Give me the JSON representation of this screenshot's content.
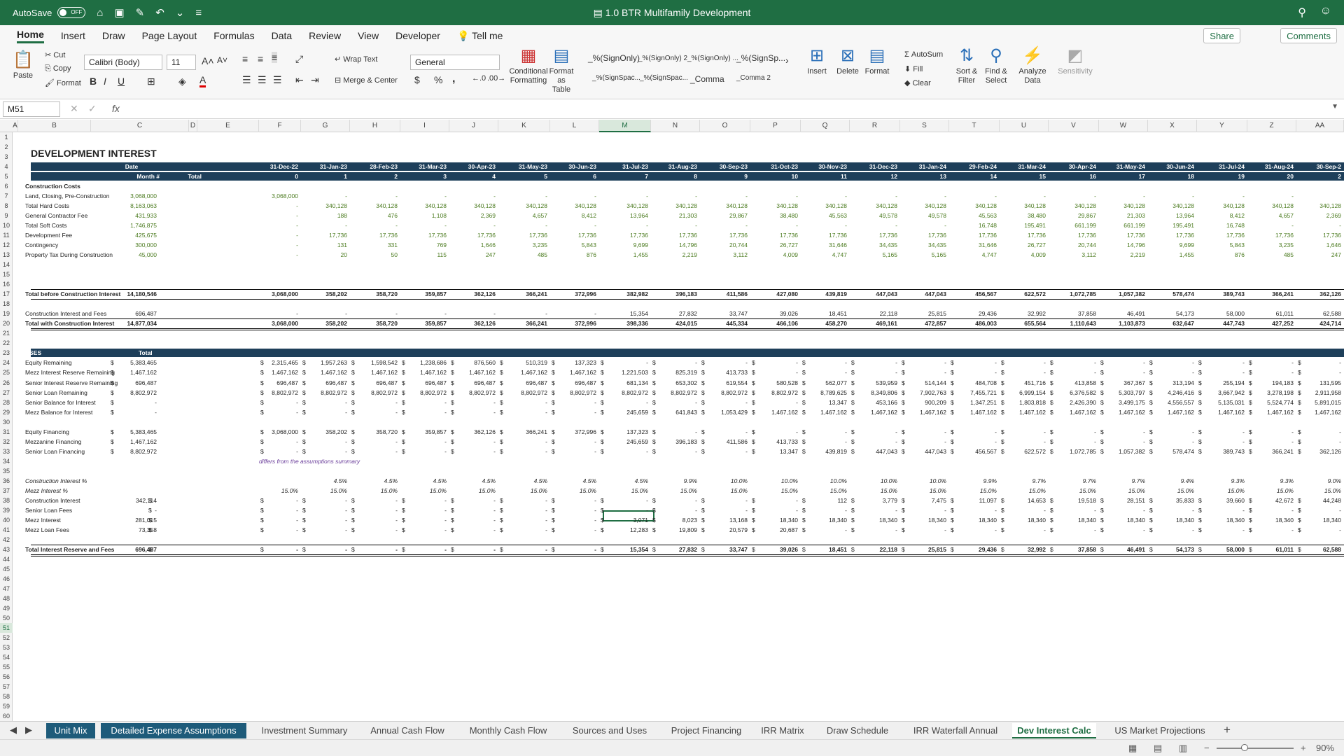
{
  "app": {
    "autosave_label": "AutoSave",
    "autosave_state": "OFF",
    "title": "1.0 BTR Multifamily Development"
  },
  "menu": [
    "Home",
    "Insert",
    "Draw",
    "Page Layout",
    "Formulas",
    "Data",
    "Review",
    "View",
    "Developer",
    "Tell me"
  ],
  "share": "Share",
  "comments": "Comments",
  "ribbon": {
    "paste": "Paste",
    "cut": "Cut",
    "copy": "Copy",
    "format_painter": "Format",
    "font_name": "Calibri (Body)",
    "font_size": "11",
    "bold": "B",
    "italic": "I",
    "underline": "U",
    "wrap_text": "Wrap Text",
    "merge_center": "Merge & Center",
    "number_format": "General",
    "currency": "$",
    "percent": "%",
    "comma": ",",
    "conditional_formatting": "Conditional Formatting",
    "format_as_table": "Format as Table",
    "styles": [
      "_%(SignOnly)",
      "_%(SignOnly) 2",
      "_%(SignOnly) ...",
      "_%(SignSp...",
      "_%(SignSpac...",
      "_%(SignSpac...",
      "_Comma",
      "_Comma 2"
    ],
    "insert": "Insert",
    "delete": "Delete",
    "format": "Format",
    "autosum": "AutoSum",
    "fill": "Fill",
    "clear": "Clear",
    "sort_filter": "Sort & Filter",
    "find_select": "Find & Select",
    "analyze_data": "Analyze Data",
    "sensitivity": "Sensitivity"
  },
  "formula_bar": {
    "name_box": "M51",
    "fx": "fx",
    "formula": ""
  },
  "columns": [
    "A",
    "B",
    "C",
    "D",
    "E",
    "F",
    "G",
    "H",
    "I",
    "J",
    "K",
    "L",
    "M",
    "N",
    "O",
    "P",
    "Q",
    "R",
    "S",
    "T",
    "U",
    "V",
    "W",
    "X",
    "Y",
    "Z",
    "AA"
  ],
  "selected_column": "M",
  "selected_row": "51",
  "rows": [
    "1",
    "2",
    "3",
    "4",
    "5",
    "6",
    "7",
    "8",
    "9",
    "10",
    "11",
    "12",
    "13",
    "14",
    "15",
    "16",
    "17",
    "18",
    "19",
    "20",
    "21",
    "22",
    "23",
    "24",
    "25",
    "26",
    "27",
    "28",
    "29",
    "30",
    "31",
    "32",
    "33",
    "34",
    "35",
    "36",
    "37",
    "38",
    "39",
    "40",
    "41",
    "42",
    "43",
    "44",
    "45",
    "46",
    "47",
    "48",
    "49",
    "50",
    "51",
    "52",
    "53",
    "54",
    "55",
    "56",
    "57",
    "58",
    "59",
    "60"
  ],
  "sheet": {
    "title": "DEVELOPMENT INTEREST",
    "date_label": "Date",
    "month_label": "Month #",
    "total_label": "Total",
    "dates": [
      "31-Dec-22",
      "31-Jan-23",
      "28-Feb-23",
      "31-Mar-23",
      "30-Apr-23",
      "31-May-23",
      "30-Jun-23",
      "31-Jul-23",
      "31-Aug-23",
      "30-Sep-23",
      "31-Oct-23",
      "30-Nov-23",
      "31-Dec-23",
      "31-Jan-24",
      "29-Feb-24",
      "31-Mar-24",
      "30-Apr-24",
      "31-May-24",
      "30-Jun-24",
      "31-Jul-24",
      "31-Aug-24",
      "30-Sep-2"
    ],
    "months": [
      "0",
      "1",
      "2",
      "3",
      "4",
      "5",
      "6",
      "7",
      "8",
      "9",
      "10",
      "11",
      "12",
      "13",
      "14",
      "15",
      "16",
      "17",
      "18",
      "19",
      "20",
      "2"
    ],
    "construction_costs_label": "Construction Costs",
    "cost_rows": [
      {
        "label": "Land, Closing, Pre-Construction",
        "total": "3,068,000",
        "vals": [
          "3,068,000",
          "-",
          "-",
          "-",
          "-",
          "-",
          "-",
          "-",
          "-",
          "-",
          "-",
          "-",
          "-",
          "-",
          "-",
          "-",
          "-",
          "-",
          "-",
          "-",
          "-",
          ""
        ]
      },
      {
        "label": "Total Hard Costs",
        "total": "8,163,063",
        "vals": [
          "-",
          "340,128",
          "340,128",
          "340,128",
          "340,128",
          "340,128",
          "340,128",
          "340,128",
          "340,128",
          "340,128",
          "340,128",
          "340,128",
          "340,128",
          "340,128",
          "340,128",
          "340,128",
          "340,128",
          "340,128",
          "340,128",
          "340,128",
          "340,128",
          "340,128"
        ]
      },
      {
        "label": "General Contractor Fee",
        "total": "431,933",
        "vals": [
          "-",
          "188",
          "476",
          "1,108",
          "2,369",
          "4,657",
          "8,412",
          "13,964",
          "21,303",
          "29,867",
          "38,480",
          "45,563",
          "49,578",
          "49,578",
          "45,563",
          "38,480",
          "29,867",
          "21,303",
          "13,964",
          "8,412",
          "4,657",
          "2,369"
        ]
      },
      {
        "label": "Total Soft Costs",
        "total": "1,746,875",
        "vals": [
          "-",
          "-",
          "-",
          "-",
          "-",
          "-",
          "-",
          "-",
          "-",
          "-",
          "-",
          "-",
          "-",
          "-",
          "16,748",
          "195,491",
          "661,199",
          "661,199",
          "195,491",
          "16,748",
          "-",
          "-"
        ]
      },
      {
        "label": "Development Fee",
        "total": "425,675",
        "vals": [
          "-",
          "17,736",
          "17,736",
          "17,736",
          "17,736",
          "17,736",
          "17,736",
          "17,736",
          "17,736",
          "17,736",
          "17,736",
          "17,736",
          "17,736",
          "17,736",
          "17,736",
          "17,736",
          "17,736",
          "17,736",
          "17,736",
          "17,736",
          "17,736",
          "17,736"
        ]
      },
      {
        "label": "Contingency",
        "total": "300,000",
        "vals": [
          "-",
          "131",
          "331",
          "769",
          "1,646",
          "3,235",
          "5,843",
          "9,699",
          "14,796",
          "20,744",
          "26,727",
          "31,646",
          "34,435",
          "34,435",
          "31,646",
          "26,727",
          "20,744",
          "14,796",
          "9,699",
          "5,843",
          "3,235",
          "1,646"
        ]
      },
      {
        "label": "Property Tax During Construction",
        "total": "45,000",
        "vals": [
          "-",
          "20",
          "50",
          "115",
          "247",
          "485",
          "876",
          "1,455",
          "2,219",
          "3,112",
          "4,009",
          "4,747",
          "5,165",
          "5,165",
          "4,747",
          "4,009",
          "3,112",
          "2,219",
          "1,455",
          "876",
          "485",
          "247"
        ]
      }
    ],
    "total_before": {
      "label": "Total before Construction Interest",
      "total": "14,180,546",
      "vals": [
        "3,068,000",
        "358,202",
        "358,720",
        "359,857",
        "362,126",
        "366,241",
        "372,996",
        "382,982",
        "396,183",
        "411,586",
        "427,080",
        "439,819",
        "447,043",
        "447,043",
        "456,567",
        "622,572",
        "1,072,785",
        "1,057,382",
        "578,474",
        "389,743",
        "366,241",
        "362,126"
      ]
    },
    "construction_interest": {
      "label": "Construction Interest and Fees",
      "total": "696,487",
      "vals": [
        "-",
        "-",
        "-",
        "-",
        "-",
        "-",
        "-",
        "15,354",
        "27,832",
        "33,747",
        "39,026",
        "18,451",
        "22,118",
        "25,815",
        "29,436",
        "32,992",
        "37,858",
        "46,491",
        "54,173",
        "58,000",
        "61,011",
        "62,588"
      ]
    },
    "total_with": {
      "label": "Total with Construction Interest",
      "total": "14,877,034",
      "vals": [
        "3,068,000",
        "358,202",
        "358,720",
        "359,857",
        "362,126",
        "366,241",
        "372,996",
        "398,336",
        "424,015",
        "445,334",
        "466,106",
        "458,270",
        "469,161",
        "472,857",
        "486,003",
        "655,564",
        "1,110,643",
        "1,103,873",
        "632,647",
        "447,743",
        "427,252",
        "424,714"
      ]
    },
    "uses_label": "USES",
    "uses_total_label": "Total",
    "uses_rows": [
      {
        "label": "Equity Remaining",
        "total": "5,383,465",
        "vals": [
          "2,315,465",
          "1,957,263",
          "1,598,542",
          "1,238,686",
          "876,560",
          "510,319",
          "137,323",
          "-",
          "-",
          "-",
          "-",
          "-",
          "-",
          "-",
          "-",
          "-",
          "-",
          "-",
          "-",
          "-",
          "-",
          "-"
        ]
      },
      {
        "label": "Mezz Interest Reserve  Remaining",
        "total": "1,467,162",
        "vals": [
          "1,467,162",
          "1,467,162",
          "1,467,162",
          "1,467,162",
          "1,467,162",
          "1,467,162",
          "1,467,162",
          "1,221,503",
          "825,319",
          "413,733",
          "-",
          "-",
          "-",
          "-",
          "-",
          "-",
          "-",
          "-",
          "-",
          "-",
          "-",
          "-"
        ]
      },
      {
        "label": "Senior Interest Reserve Remaining",
        "total": "696,487",
        "vals": [
          "696,487",
          "696,487",
          "696,487",
          "696,487",
          "696,487",
          "696,487",
          "696,487",
          "681,134",
          "653,302",
          "619,554",
          "580,528",
          "562,077",
          "539,959",
          "514,144",
          "484,708",
          "451,716",
          "413,858",
          "367,367",
          "313,194",
          "255,194",
          "194,183",
          "131,595"
        ]
      },
      {
        "label": "Senior Loan Remaining",
        "total": "8,802,972",
        "vals": [
          "8,802,972",
          "8,802,972",
          "8,802,972",
          "8,802,972",
          "8,802,972",
          "8,802,972",
          "8,802,972",
          "8,802,972",
          "8,802,972",
          "8,802,972",
          "8,802,972",
          "8,789,625",
          "8,349,806",
          "7,902,763",
          "7,455,721",
          "6,999,154",
          "6,376,582",
          "5,303,797",
          "4,246,416",
          "3,667,942",
          "3,278,198",
          "2,911,958"
        ]
      },
      {
        "label": "Senior Balance for Interest",
        "total": "-",
        "vals": [
          "-",
          "-",
          "-",
          "-",
          "-",
          "-",
          "-",
          "-",
          "-",
          "-",
          "-",
          "13,347",
          "453,166",
          "900,209",
          "1,347,251",
          "1,803,818",
          "2,426,390",
          "3,499,175",
          "4,556,557",
          "5,135,031",
          "5,524,774",
          "5,891,015"
        ]
      },
      {
        "label": "Mezz Balance for Interest",
        "total": "-",
        "vals": [
          "-",
          "-",
          "-",
          "-",
          "-",
          "-",
          "-",
          "245,659",
          "641,843",
          "1,053,429",
          "1,467,162",
          "1,467,162",
          "1,467,162",
          "1,467,162",
          "1,467,162",
          "1,467,162",
          "1,467,162",
          "1,467,162",
          "1,467,162",
          "1,467,162",
          "1,467,162",
          "1,467,162"
        ]
      }
    ],
    "fin_rows": [
      {
        "label": "Equity Financing",
        "total": "5,383,465",
        "vals": [
          "3,068,000",
          "358,202",
          "358,720",
          "359,857",
          "362,126",
          "366,241",
          "372,996",
          "137,323",
          "-",
          "-",
          "-",
          "-",
          "-",
          "-",
          "-",
          "-",
          "-",
          "-",
          "-",
          "-",
          "-",
          "-"
        ]
      },
      {
        "label": "Mezzanine Financing",
        "total": "1,467,162",
        "vals": [
          "-",
          "-",
          "-",
          "-",
          "-",
          "-",
          "-",
          "245,659",
          "396,183",
          "411,586",
          "413,733",
          "-",
          "-",
          "-",
          "-",
          "-",
          "-",
          "-",
          "-",
          "-",
          "-",
          "-"
        ]
      },
      {
        "label": "Senior Loan Financing",
        "total": "8,802,972",
        "vals": [
          "-",
          "-",
          "-",
          "-",
          "-",
          "-",
          "-",
          "-",
          "-",
          "-",
          "13,347",
          "439,819",
          "447,043",
          "447,043",
          "456,567",
          "622,572",
          "1,072,785",
          "1,057,382",
          "578,474",
          "389,743",
          "366,241",
          "362,126"
        ]
      }
    ],
    "note": "differs from the assumptions summary",
    "rate_rows": [
      {
        "label": "Construction Interest %",
        "vals": [
          "",
          "4.5%",
          "4.5%",
          "4.5%",
          "4.5%",
          "4.5%",
          "4.5%",
          "4.5%",
          "9.9%",
          "10.0%",
          "10.0%",
          "10.0%",
          "10.0%",
          "10.0%",
          "9.9%",
          "9.7%",
          "9.7%",
          "9.7%",
          "9.4%",
          "9.3%",
          "9.3%",
          "9.0%"
        ]
      },
      {
        "label": "Mezz Interest %",
        "vals": [
          "15.0%",
          "15.0%",
          "15.0%",
          "15.0%",
          "15.0%",
          "15.0%",
          "15.0%",
          "15.0%",
          "15.0%",
          "15.0%",
          "15.0%",
          "15.0%",
          "15.0%",
          "15.0%",
          "15.0%",
          "15.0%",
          "15.0%",
          "15.0%",
          "15.0%",
          "15.0%",
          "15.0%",
          "15.0%"
        ]
      }
    ],
    "fee_rows": [
      {
        "label": "Construction Interest",
        "total": "342,114",
        "vals": [
          "-",
          "-",
          "-",
          "-",
          "-",
          "-",
          "-",
          "-",
          "-",
          "-",
          "-",
          "112",
          "3,779",
          "7,475",
          "11,097",
          "14,653",
          "19,518",
          "28,151",
          "35,833",
          "39,660",
          "42,672",
          "44,248"
        ]
      },
      {
        "label": "Senior Loan Fees",
        "total": "-",
        "vals": [
          "-",
          "-",
          "-",
          "-",
          "-",
          "-",
          "-",
          "-",
          "-",
          "-",
          "-",
          "-",
          "-",
          "-",
          "-",
          "-",
          "-",
          "-",
          "-",
          "-",
          "-",
          "-"
        ]
      },
      {
        "label": "Mezz Interest",
        "total": "281,015",
        "vals": [
          "-",
          "-",
          "-",
          "-",
          "-",
          "-",
          "-",
          "3,071",
          "8,023",
          "13,168",
          "18,340",
          "18,340",
          "18,340",
          "18,340",
          "18,340",
          "18,340",
          "18,340",
          "18,340",
          "18,340",
          "18,340",
          "18,340",
          "18,340"
        ]
      },
      {
        "label": "Mezz Loan Fees",
        "total": "73,358",
        "vals": [
          "-",
          "-",
          "-",
          "-",
          "-",
          "-",
          "-",
          "12,283",
          "19,809",
          "20,579",
          "20,687",
          "-",
          "-",
          "-",
          "-",
          "-",
          "-",
          "-",
          "-",
          "-",
          "-",
          "-"
        ]
      }
    ],
    "total_fees": {
      "label": "Total Interest Reserve and Fees",
      "total": "696,487",
      "vals": [
        "-",
        "-",
        "-",
        "-",
        "-",
        "-",
        "-",
        "15,354",
        "27,832",
        "33,747",
        "39,026",
        "18,451",
        "22,118",
        "25,815",
        "29,436",
        "32,992",
        "37,858",
        "46,491",
        "54,173",
        "58,000",
        "61,011",
        "62,588"
      ]
    },
    "dollar": "$"
  },
  "sheet_tabs": [
    "Unit Mix",
    "Detailed Expense Assumptions",
    "Investment Summary",
    "Annual Cash Flow",
    "Monthly Cash Flow",
    "Sources and Uses",
    "Project Financing",
    "IRR Matrix",
    "Draw Schedule",
    "IRR Waterfall Annual",
    "Dev Interest Calc",
    "US Market Projections"
  ],
  "active_sheet": "Dev Interest Calc",
  "add_sheet": "+",
  "zoom": "90%",
  "colors": {
    "excel_green": "#1f6e43",
    "header_navy": "#1e3f5a",
    "tab_blue": "#1e5b7a",
    "input_green": "#4a7a1e"
  }
}
